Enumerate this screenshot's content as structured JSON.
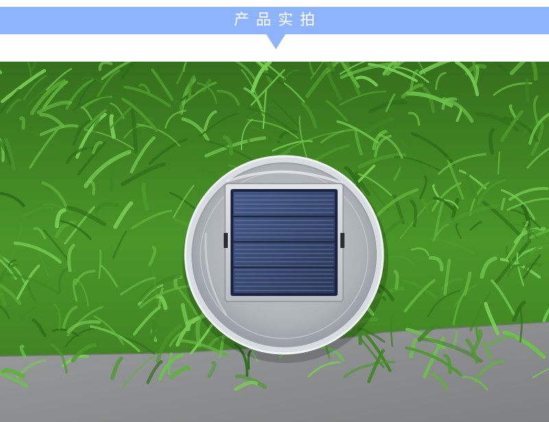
{
  "header": {
    "title": "产品实拍"
  },
  "photo": {
    "subject": "solar-panel-lamp-top-view"
  },
  "colors": {
    "banner": "#8fb4ff",
    "grass": "#3f8a22",
    "pavement": "#8e9091",
    "panel": "#2b3d66"
  }
}
